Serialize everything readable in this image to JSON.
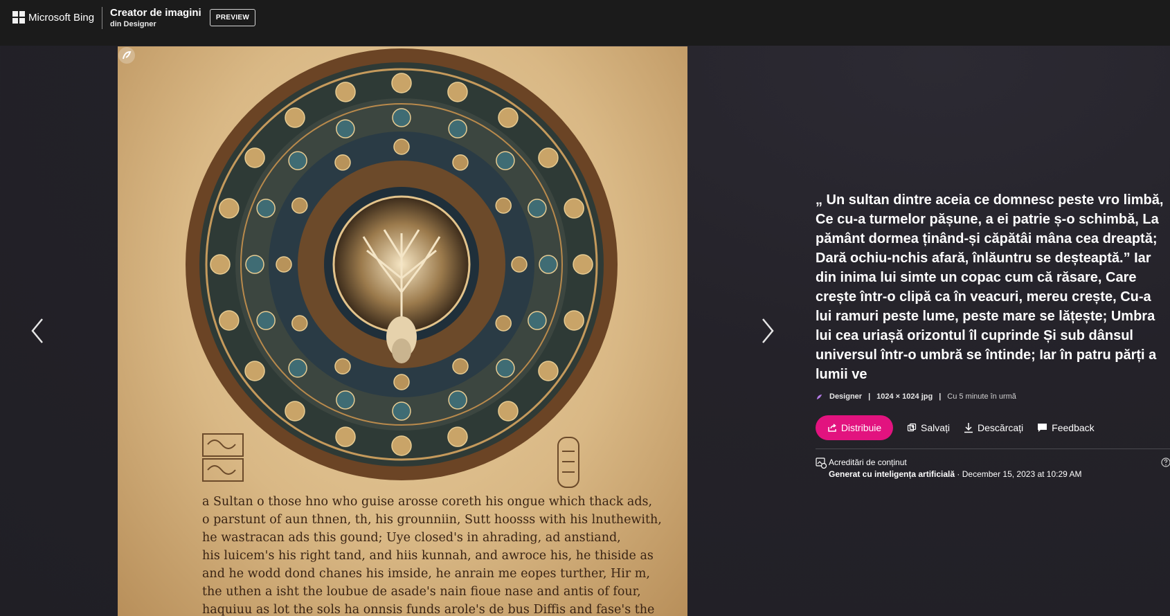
{
  "header": {
    "brand": "Microsoft Bing",
    "app_title": "Creator de imagini",
    "app_subtitle": "din Designer",
    "preview_badge": "PREVIEW"
  },
  "image": {
    "text_lines": [
      "a Sultan o those hno who guise arosse coreth his ongue which thack ads,",
      "o parstunt of aun thnen, th, his grounniin, Sutt hoosss with his lnuthewith,",
      "he wastracan ads this gound; Uye closed's in ahrading, ad anstiand,",
      "his luicem's his right tand, and hiis kunnah, and awroce his, he thiside as",
      "and he wodd dond chanes his imside, he anrain me eopes turther, Hir m,",
      "the uthen a isht the loubue de asade's nain fioue nase and antis of four,",
      "haquiuu as lot the sols ha onnsis funds arole's de bus Diffis and fase's the"
    ],
    "alt": "Tree of life mandala with illuminated manuscript text"
  },
  "prompt_text": "„ Un sultan dintre aceia ce domnesc peste vro limbă, Ce cu-a turmelor pășune, a ei patrie ș-o schimbă, La pământ dormea ținând-și căpătâi mâna cea dreaptă; Dară ochiu-nchis afară, înlăuntru se deșteaptă.” Iar din inima lui simte un copac cum că răsare, Care crește într-o clipă ca în veacuri, mereu crește, Cu-a lui ramuri peste lume, peste mare se lățește; Umbra lui cea uriașă orizontul îl cuprinde Și sub dânsul universul într-o umbră se întinde; Iar în patru părți a lumii ve",
  "meta": {
    "source": "Designer",
    "dimensions": "1024 × 1024 jpg",
    "time": "Cu 5 minute în urmă",
    "sep": "|"
  },
  "actions": {
    "share": "Distribuie",
    "save": "Salvați",
    "download": "Descărcați",
    "feedback": "Feedback"
  },
  "credentials": {
    "title": "Acreditări de conținut",
    "generated": "Generat cu inteligența artificială",
    "date": " · December 15, 2023 at 10:29 AM"
  },
  "colors": {
    "share_button": "#e2137f",
    "topbar": "#1b1b1b",
    "background": "#232228"
  }
}
